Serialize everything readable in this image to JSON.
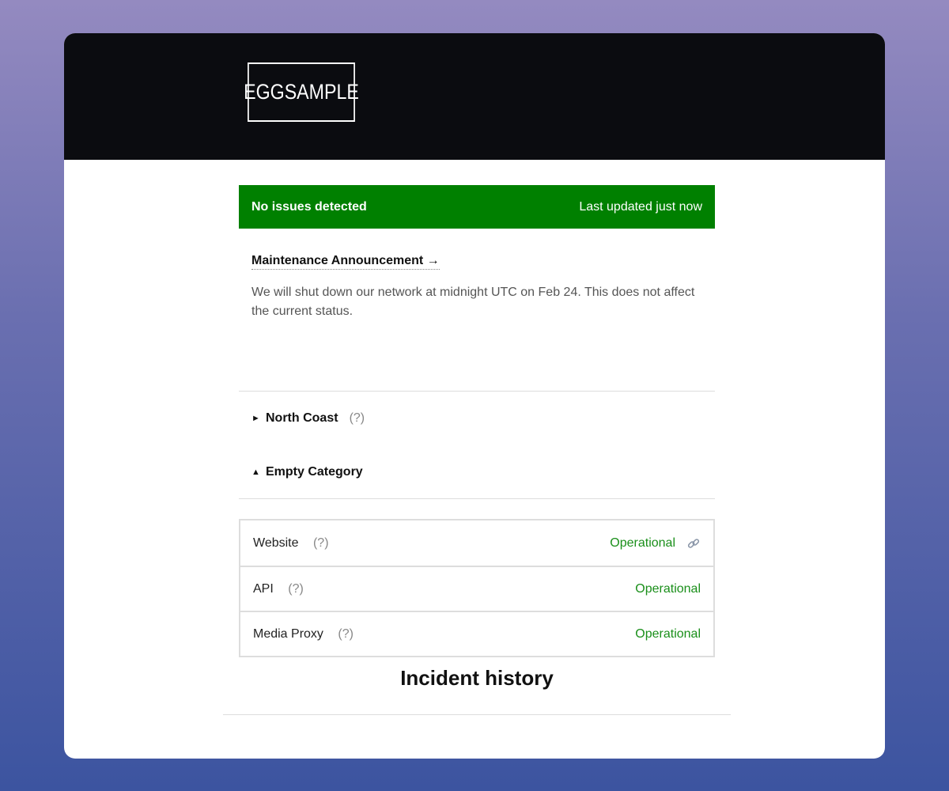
{
  "brand": {
    "logo_text": "EGGSAMPLE"
  },
  "status": {
    "title": "No issues detected",
    "updated": "Last updated just now",
    "color": "#008000"
  },
  "announcement": {
    "link_label": "Maintenance Announcement →",
    "text": "We will shut down our network at midnight UTC on Feb 24. This does not affect the current status."
  },
  "groups": [
    {
      "name": "North Coast",
      "help": "(?)",
      "expanded": false
    },
    {
      "name": "Empty Category",
      "help": "",
      "expanded": true
    }
  ],
  "components": [
    {
      "name": "Website",
      "help": "(?)",
      "status": "Operational",
      "icon": "link-icon"
    },
    {
      "name": "API",
      "help": "(?)",
      "status": "Operational"
    },
    {
      "name": "Media Proxy",
      "help": "(?)",
      "status": "Operational"
    }
  ],
  "incidents": {
    "title": "Incident history"
  },
  "colors": {
    "operational": "#1a8f1a",
    "header_bg": "#0b0c10"
  }
}
